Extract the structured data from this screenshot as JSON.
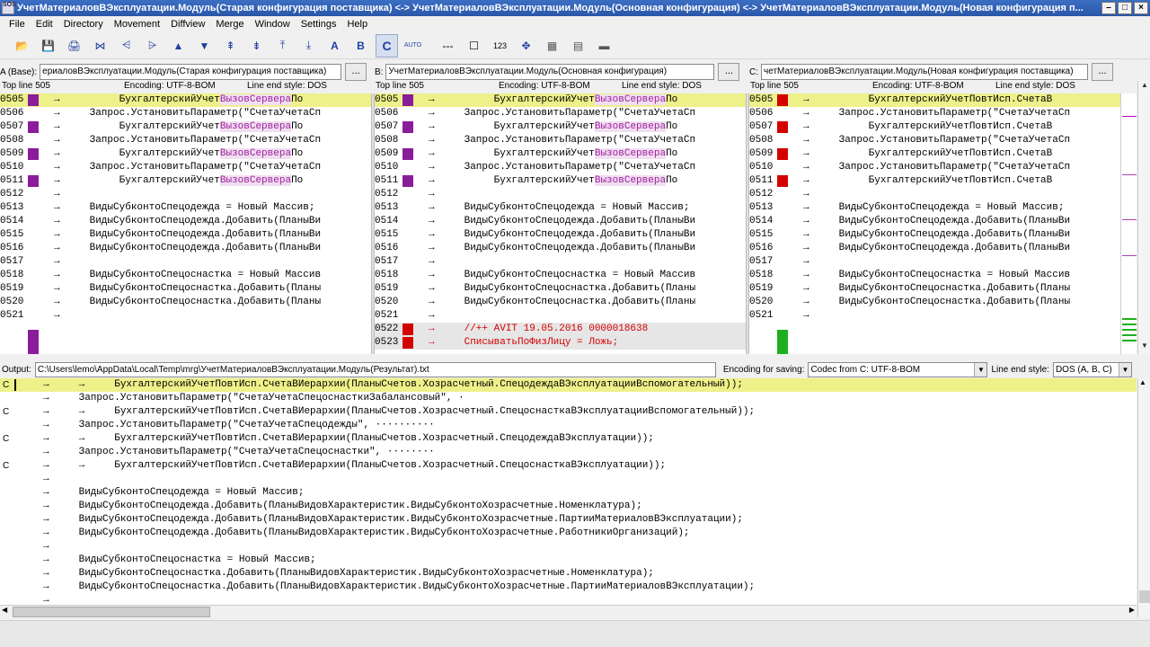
{
  "window": {
    "title": "УчетМатериаловВЭксплуатации.Модуль(Старая конфигурация поставщика) <-> УчетМатериаловВЭксплуатации.Модуль(Основная конфигурация) <-> УчетМатериаловВЭксплуатации.Модуль(Новая конфигурация п...",
    "app_icon_text": "SOS"
  },
  "menu": [
    "File",
    "Edit",
    "Directory",
    "Movement",
    "Diffview",
    "Merge",
    "Window",
    "Settings",
    "Help"
  ],
  "toolbar": {
    "icons": [
      "open-icon",
      "save-icon",
      "print-icon",
      "goto-first-icon",
      "goto-prev-delta-icon",
      "goto-next-delta-icon",
      "goto-prev-conflict-icon",
      "goto-next-conflict-icon",
      "goto-prev-unsolved-icon",
      "goto-next-unsolved-icon",
      "goto-prev-unsolved-conflict-icon",
      "goto-next-unsolved-conflict-icon",
      "choose-a-icon",
      "choose-b-icon",
      "choose-c-icon",
      "auto-advance-icon",
      "show-whitespace-icon",
      "show-whitespace-chars-icon",
      "line-numbers-icon",
      "word-wrap-icon",
      "split-vertical-icon",
      "split-horizontal-icon",
      "overview-icon"
    ],
    "texts": {
      "a": "A",
      "b": "B",
      "c": "C",
      "auto": "AUTO",
      "num": "123",
      "dash": "---"
    }
  },
  "panes": [
    {
      "label": "A (Base):",
      "path": "ериаловВЭксплуатации.Модуль(Старая конфигурация поставщика)",
      "top_line": "Top line 505",
      "encoding": "Encoding: UTF-8-BOM",
      "line_end": "Line end style: DOS",
      "color": "#8a1d9a",
      "lines": [
        {
          "n": "0505",
          "m": "purple",
          "hl": "yellow",
          "t": "→          БухгалтерскийУчет",
          "p": "ВызовСервера",
          "r": "По"
        },
        {
          "n": "0506",
          "m": "",
          "hl": "",
          "t": "→     Запрос.УстановитьПараметр(\"СчетаУчетаСп"
        },
        {
          "n": "0507",
          "m": "purple",
          "hl": "",
          "t": "→          БухгалтерскийУчет",
          "p": "ВызовСервера",
          "r": "По"
        },
        {
          "n": "0508",
          "m": "",
          "hl": "",
          "t": "→     Запрос.УстановитьПараметр(\"СчетаУчетаСп"
        },
        {
          "n": "0509",
          "m": "purple",
          "hl": "",
          "t": "→          БухгалтерскийУчет",
          "p": "ВызовСервера",
          "r": "По"
        },
        {
          "n": "0510",
          "m": "",
          "hl": "",
          "t": "→     Запрос.УстановитьПараметр(\"СчетаУчетаСп"
        },
        {
          "n": "0511",
          "m": "purple",
          "hl": "",
          "t": "→          БухгалтерскийУчет",
          "p": "ВызовСервера",
          "r": "По"
        },
        {
          "n": "0512",
          "m": "",
          "hl": "",
          "t": "→"
        },
        {
          "n": "0513",
          "m": "",
          "hl": "",
          "t": "→     ВидыСубконтоСпецодежда = Новый Массив;"
        },
        {
          "n": "0514",
          "m": "",
          "hl": "",
          "t": "→     ВидыСубконтоСпецодежда.Добавить(ПланыВи"
        },
        {
          "n": "0515",
          "m": "",
          "hl": "",
          "t": "→     ВидыСубконтоСпецодежда.Добавить(ПланыВи"
        },
        {
          "n": "0516",
          "m": "",
          "hl": "",
          "t": "→     ВидыСубконтоСпецодежда.Добавить(ПланыВи"
        },
        {
          "n": "0517",
          "m": "",
          "hl": "",
          "t": "→"
        },
        {
          "n": "0518",
          "m": "",
          "hl": "",
          "t": "→     ВидыСубконтоСпецоснастка = Новый Массив"
        },
        {
          "n": "0519",
          "m": "",
          "hl": "",
          "t": "→     ВидыСубконтоСпецоснастка.Добавить(Планы"
        },
        {
          "n": "0520",
          "m": "",
          "hl": "",
          "t": "→     ВидыСубконтоСпецоснастка.Добавить(Планы"
        },
        {
          "n": "0521",
          "m": "",
          "hl": "",
          "t": "→"
        }
      ]
    },
    {
      "label": "B:",
      "path": "УчетМатериаловВЭксплуатации.Модуль(Основная конфигурация)",
      "top_line": "Top line 505",
      "encoding": "Encoding: UTF-8-BOM",
      "line_end": "Line end style: DOS",
      "color": "#d40000",
      "lines": [
        {
          "n": "0505",
          "m": "purple",
          "hl": "yellow",
          "t": "→          БухгалтерскийУчет",
          "p": "ВызовСервера",
          "r": "По"
        },
        {
          "n": "0506",
          "m": "",
          "hl": "",
          "t": "→     Запрос.УстановитьПараметр(\"СчетаУчетаСп"
        },
        {
          "n": "0507",
          "m": "purple",
          "hl": "",
          "t": "→          БухгалтерскийУчет",
          "p": "ВызовСервера",
          "r": "По"
        },
        {
          "n": "0508",
          "m": "",
          "hl": "",
          "t": "→     Запрос.УстановитьПараметр(\"СчетаУчетаСп"
        },
        {
          "n": "0509",
          "m": "purple",
          "hl": "",
          "t": "→          БухгалтерскийУчет",
          "p": "ВызовСервера",
          "r": "По"
        },
        {
          "n": "0510",
          "m": "",
          "hl": "",
          "t": "→     Запрос.УстановитьПараметр(\"СчетаУчетаСп"
        },
        {
          "n": "0511",
          "m": "purple",
          "hl": "",
          "t": "→          БухгалтерскийУчет",
          "p": "ВызовСервера",
          "r": "По"
        },
        {
          "n": "0512",
          "m": "",
          "hl": "",
          "t": "→"
        },
        {
          "n": "0513",
          "m": "",
          "hl": "",
          "t": "→     ВидыСубконтоСпецодежда = Новый Массив;"
        },
        {
          "n": "0514",
          "m": "",
          "hl": "",
          "t": "→     ВидыСубконтоСпецодежда.Добавить(ПланыВи"
        },
        {
          "n": "0515",
          "m": "",
          "hl": "",
          "t": "→     ВидыСубконтоСпецодежда.Добавить(ПланыВи"
        },
        {
          "n": "0516",
          "m": "",
          "hl": "",
          "t": "→     ВидыСубконтоСпецодежда.Добавить(ПланыВи"
        },
        {
          "n": "0517",
          "m": "",
          "hl": "",
          "t": "→"
        },
        {
          "n": "0518",
          "m": "",
          "hl": "",
          "t": "→     ВидыСубконтоСпецоснастка = Новый Массив"
        },
        {
          "n": "0519",
          "m": "",
          "hl": "",
          "t": "→     ВидыСубконтоСпецоснастка.Добавить(Планы"
        },
        {
          "n": "0520",
          "m": "",
          "hl": "",
          "t": "→     ВидыСубконтоСпецоснастка.Добавить(Планы"
        },
        {
          "n": "0521",
          "m": "",
          "hl": "",
          "t": "→"
        },
        {
          "n": "0522",
          "m": "red",
          "hl": "gray",
          "red": true,
          "t": "→     //++ AVIT 19.05.2016 0000018638"
        },
        {
          "n": "0523",
          "m": "red",
          "hl": "gray",
          "red": true,
          "t": "→     СписыватьПоФизЛицу = Ложь;"
        }
      ]
    },
    {
      "label": "C:",
      "path": "четМатериаловВЭксплуатации.Модуль(Новая конфигурация поставщика)",
      "top_line": "Top line 505",
      "encoding": "Encoding: UTF-8-BOM",
      "line_end": "Line end style: DOS",
      "color": "#1db01d",
      "lines": [
        {
          "n": "0505",
          "m": "red",
          "hl": "yellow",
          "t": "→          БухгалтерскийУчетПовтИсп.СчетаВ"
        },
        {
          "n": "0506",
          "m": "",
          "hl": "",
          "t": "→     Запрос.УстановитьПараметр(\"СчетаУчетаСп"
        },
        {
          "n": "0507",
          "m": "red",
          "hl": "",
          "t": "→          БухгалтерскийУчетПовтИсп.СчетаВ"
        },
        {
          "n": "0508",
          "m": "",
          "hl": "",
          "t": "→     Запрос.УстановитьПараметр(\"СчетаУчетаСп"
        },
        {
          "n": "0509",
          "m": "red",
          "hl": "",
          "t": "→          БухгалтерскийУчетПовтИсп.СчетаВ"
        },
        {
          "n": "0510",
          "m": "",
          "hl": "",
          "t": "→     Запрос.УстановитьПараметр(\"СчетаУчетаСп"
        },
        {
          "n": "0511",
          "m": "red",
          "hl": "",
          "t": "→          БухгалтерскийУчетПовтИсп.СчетаВ"
        },
        {
          "n": "0512",
          "m": "",
          "hl": "",
          "t": "→"
        },
        {
          "n": "0513",
          "m": "",
          "hl": "",
          "t": "→     ВидыСубконтоСпецодежда = Новый Массив;"
        },
        {
          "n": "0514",
          "m": "",
          "hl": "",
          "t": "→     ВидыСубконтоСпецодежда.Добавить(ПланыВи"
        },
        {
          "n": "0515",
          "m": "",
          "hl": "",
          "t": "→     ВидыСубконтоСпецодежда.Добавить(ПланыВи"
        },
        {
          "n": "0516",
          "m": "",
          "hl": "",
          "t": "→     ВидыСубконтоСпецодежда.Добавить(ПланыВи"
        },
        {
          "n": "0517",
          "m": "",
          "hl": "",
          "t": "→"
        },
        {
          "n": "0518",
          "m": "",
          "hl": "",
          "t": "→     ВидыСубконтоСпецоснастка = Новый Массив"
        },
        {
          "n": "0519",
          "m": "",
          "hl": "",
          "t": "→     ВидыСубконтоСпецоснастка.Добавить(Планы"
        },
        {
          "n": "0520",
          "m": "",
          "hl": "",
          "t": "→     ВидыСубконтоСпецоснастка.Добавить(Планы"
        },
        {
          "n": "0521",
          "m": "",
          "hl": "",
          "t": "→"
        }
      ]
    }
  ],
  "output": {
    "label": "Output:",
    "path": "C:\\Users\\lemo\\AppData\\Local\\Temp\\mrg\\УчетМатериаловВЭксплуатации.Модуль(Результат).txt",
    "encoding_label": "Encoding for saving:",
    "encoding_value": "Codec from C: UTF-8-BOM",
    "line_end_label": "Line end style:",
    "line_end_value": "DOS (A, B, C)",
    "lines": [
      {
        "c": "C",
        "hl": "yellow",
        "t": "→     →     БухгалтерскийУчетПовтИсп.СчетаВИерархии(ПланыСчетов.Хозрасчетный.СпецодеждаВЭксплуатацииВспомогательный));"
      },
      {
        "c": "",
        "hl": "",
        "t": "→     Запрос.УстановитьПараметр(\"СчетаУчетаСпецоснасткиЗабалансовый\", ·"
      },
      {
        "c": "C",
        "hl": "",
        "t": "→     →     БухгалтерскийУчетПовтИсп.СчетаВИерархии(ПланыСчетов.Хозрасчетный.СпецоснасткаВЭксплуатацииВспомогательный));"
      },
      {
        "c": "",
        "hl": "",
        "t": "→     Запрос.УстановитьПараметр(\"СчетаУчетаСпецодежды\", ··········"
      },
      {
        "c": "C",
        "hl": "",
        "t": "→     →     БухгалтерскийУчетПовтИсп.СчетаВИерархии(ПланыСчетов.Хозрасчетный.СпецодеждаВЭксплуатации));"
      },
      {
        "c": "",
        "hl": "",
        "t": "→     Запрос.УстановитьПараметр(\"СчетаУчетаСпецоснастки\", ········"
      },
      {
        "c": "C",
        "hl": "",
        "t": "→     →     БухгалтерскийУчетПовтИсп.СчетаВИерархии(ПланыСчетов.Хозрасчетный.СпецоснасткаВЭксплуатации));"
      },
      {
        "c": "",
        "hl": "",
        "t": "→"
      },
      {
        "c": "",
        "hl": "",
        "t": "→     ВидыСубконтоСпецодежда = Новый Массив;"
      },
      {
        "c": "",
        "hl": "",
        "t": "→     ВидыСубконтоСпецодежда.Добавить(ПланыВидовХарактеристик.ВидыСубконтоХозрасчетные.Номенклатура);"
      },
      {
        "c": "",
        "hl": "",
        "t": "→     ВидыСубконтоСпецодежда.Добавить(ПланыВидовХарактеристик.ВидыСубконтоХозрасчетные.ПартииМатериаловВЭксплуатации);"
      },
      {
        "c": "",
        "hl": "",
        "t": "→     ВидыСубконтоСпецодежда.Добавить(ПланыВидовХарактеристик.ВидыСубконтоХозрасчетные.РаботникиОрганизаций);"
      },
      {
        "c": "",
        "hl": "",
        "t": "→"
      },
      {
        "c": "",
        "hl": "",
        "t": "→     ВидыСубконтоСпецоснастка = Новый Массив;"
      },
      {
        "c": "",
        "hl": "",
        "t": "→     ВидыСубконтоСпецоснастка.Добавить(ПланыВидовХарактеристик.ВидыСубконтоХозрасчетные.Номенклатура);"
      },
      {
        "c": "",
        "hl": "",
        "t": "→     ВидыСубконтоСпецоснастка.Добавить(ПланыВидовХарактеристик.ВидыСубконтоХозрасчетные.ПартииМатериаловВЭксплуатации);"
      },
      {
        "c": "",
        "hl": "",
        "t": "→"
      }
    ]
  }
}
